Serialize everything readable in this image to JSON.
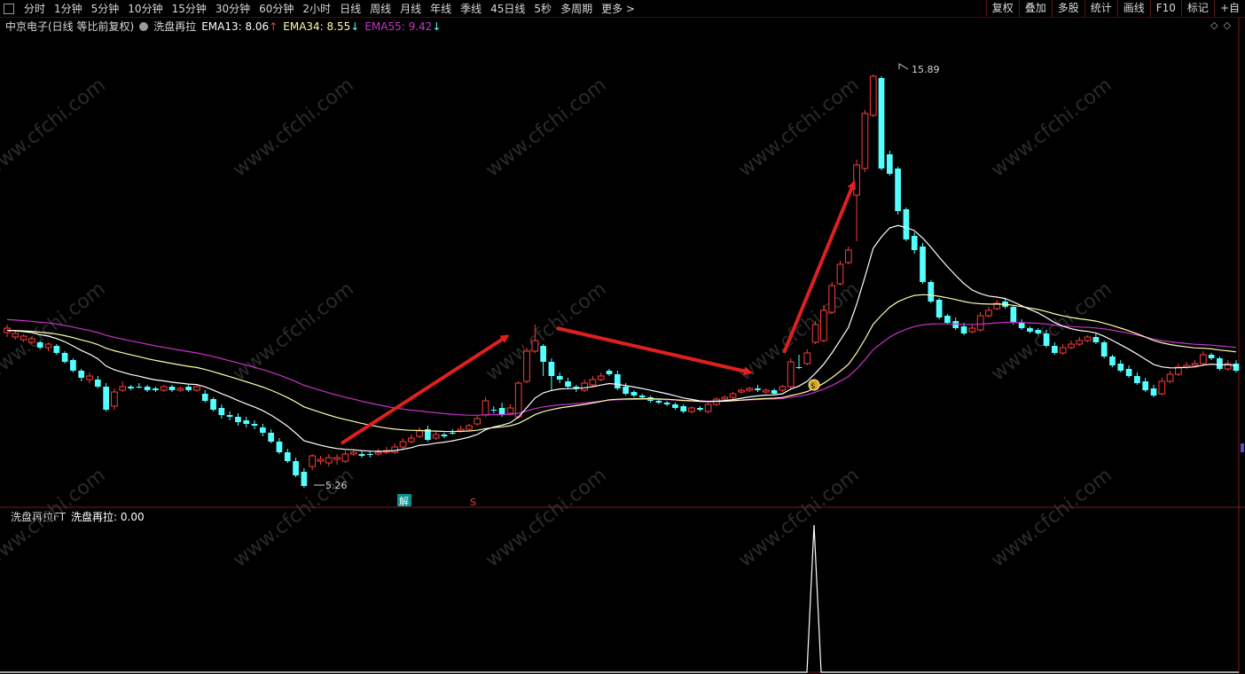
{
  "toolbar": {
    "periods": [
      "分时",
      "1分钟",
      "5分钟",
      "10分钟",
      "15分钟",
      "30分钟",
      "60分钟",
      "2小时",
      "日线",
      "周线",
      "月线",
      "年线",
      "季线",
      "45日线",
      "5秒",
      "多周期",
      "更多"
    ],
    "more_suffix": ">",
    "tools": [
      "复权",
      "叠加",
      "多股",
      "统计",
      "画线",
      "F10",
      "标记",
      "+自"
    ]
  },
  "main_legend": {
    "stock": "中京电子(日线 等比前复权)",
    "indicator": "洗盘再拉",
    "ema13": "EMA13: 8.06",
    "ema34": "EMA34: 8.55",
    "ema55": "EMA55: 9.42",
    "up_arrow": "↑",
    "down_arrow": "↓"
  },
  "sub_legend": {
    "indicator": "洗盘再拉FT",
    "value": "洗盘再拉: 0.00"
  },
  "annotations": {
    "high_label": "15.89",
    "low_label": "5.26",
    "signal_jie": "解",
    "signal_s": "S",
    "coin": "$"
  },
  "watermark": "www.cfchi.com",
  "colors": {
    "up": "#ff3c3c",
    "down": "#54ffff",
    "ema13": "#ffffff",
    "ema34": "#fffcb0",
    "ema55": "#c832c8",
    "arrow": "#e0201e",
    "divider": "#7a1a1a"
  }
}
